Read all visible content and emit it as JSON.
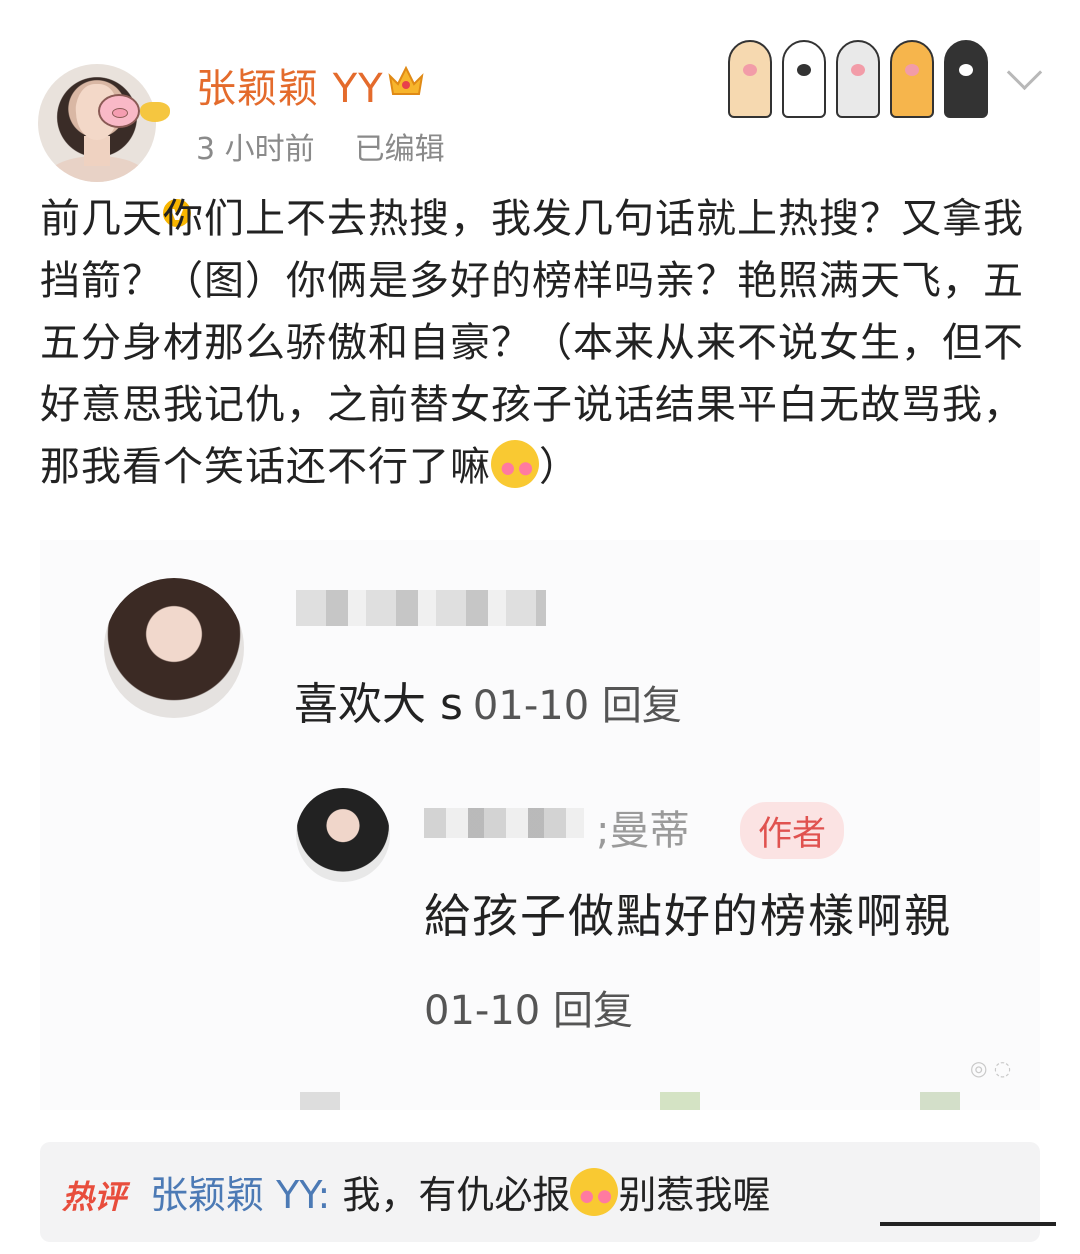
{
  "header": {
    "username": "张颖颖 YY",
    "time": "3 小时前",
    "edited": "已编辑"
  },
  "post": {
    "text": "前几天你们上不去热搜，我发几句话就上热搜？又拿我挡箭？（图）你俩是多好的榜样吗亲？艳照满天飞，五五分身材那么骄傲和自豪？（本来从来不说女生，但不好意思我记仇，之前替女孩子说话结果平白无故骂我，那我看个笑话还不行了嘛",
    "text_end": "）"
  },
  "screenshot": {
    "comment1": {
      "text": "喜欢大 s",
      "date": "01-10 回复"
    },
    "comment2": {
      "name": ";曼蒂",
      "badge": "作者",
      "text": "給孩子做點好的榜樣啊親",
      "date": "01-10 回复"
    }
  },
  "hot_comment": {
    "tag": "热评",
    "author": "张颖颖 YY:",
    "text": " 我，有仇必报",
    "text_after": "别惹我喔"
  },
  "colors": {
    "username": "#e46b2c",
    "hot_tag": "#e84d3c",
    "hot_author": "#4c7ab5",
    "author_badge": "#e0524f"
  }
}
